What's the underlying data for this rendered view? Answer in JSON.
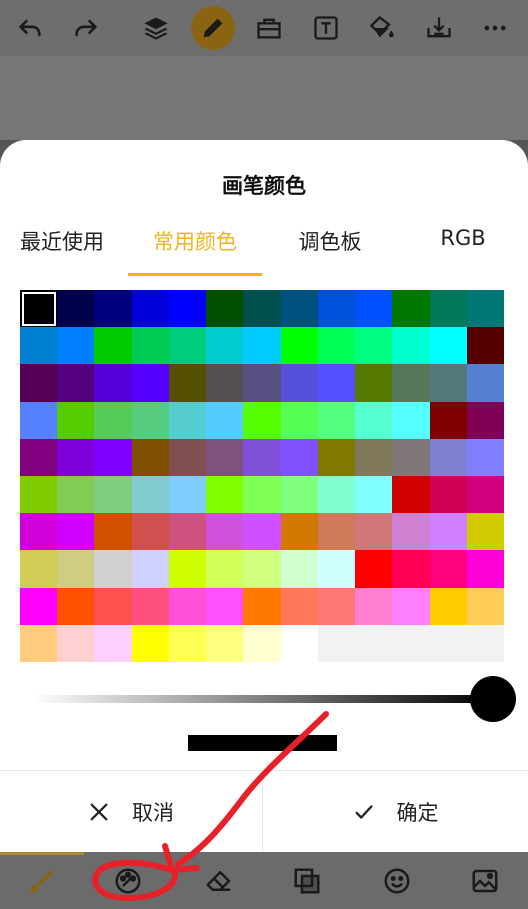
{
  "toolbar": {
    "items": [
      "undo-icon",
      "redo-icon",
      "layers-icon",
      "pen-icon",
      "toolbox-icon",
      "text-icon",
      "fill-bucket-icon",
      "import-icon",
      "more-icon"
    ],
    "active": "pen-icon"
  },
  "sheet": {
    "title": "画笔颜色",
    "tabs": [
      {
        "label": "最近使用",
        "active": false
      },
      {
        "label": "常用颜色",
        "active": true
      },
      {
        "label": "调色板",
        "active": false
      },
      {
        "label": "RGB",
        "active": false
      }
    ],
    "selected_color": "#000000",
    "brightness_level": 1.0,
    "preview_color": "#000000",
    "colors": [
      [
        "#000000",
        "#00004b",
        "#00007f",
        "#0000d9",
        "#0000ff",
        "#005000",
        "#005050",
        "#00507f",
        "#0050d9",
        "#0050ff",
        "#007800",
        "#00785a",
        "#007878"
      ],
      [
        "#0080d0",
        "#0080ff",
        "#00cc00",
        "#00cc55",
        "#00cc80",
        "#00ccd0",
        "#00ccff",
        "#00ff00",
        "#00ff55",
        "#00ff80",
        "#00ffd0",
        "#00ffff",
        "#550000"
      ],
      [
        "#550055",
        "#55007f",
        "#5500d9",
        "#5500ff",
        "#555000",
        "#555050",
        "#55507f",
        "#5550d9",
        "#5550ff",
        "#557800",
        "#55785a",
        "#557878",
        "#5580d0"
      ],
      [
        "#5580ff",
        "#55cc00",
        "#55cc55",
        "#55cc80",
        "#55ccd0",
        "#55ccff",
        "#55ff00",
        "#55ff55",
        "#55ff80",
        "#55ffd0",
        "#55ffff",
        "#800000",
        "#800055"
      ],
      [
        "#80007f",
        "#8000d9",
        "#8000ff",
        "#805000",
        "#805050",
        "#80507f",
        "#8050d9",
        "#8050ff",
        "#807800",
        "#80785a",
        "#807878",
        "#8080d0",
        "#8080ff"
      ],
      [
        "#80cc00",
        "#80cc55",
        "#80cc80",
        "#80ccd0",
        "#80ccff",
        "#80ff00",
        "#80ff55",
        "#80ff80",
        "#80ffd0",
        "#80ffff",
        "#d00000",
        "#d00055",
        "#d0007f"
      ],
      [
        "#d000d9",
        "#d000ff",
        "#d05000",
        "#d05050",
        "#d0507f",
        "#d050d9",
        "#d050ff",
        "#d07800",
        "#d0785a",
        "#d07878",
        "#d080d0",
        "#d080ff",
        "#d0cc00"
      ],
      [
        "#d0cc55",
        "#d0cc80",
        "#d0d0d0",
        "#d0d0ff",
        "#d0ff00",
        "#d0ff55",
        "#d0ff80",
        "#d0ffd0",
        "#d0ffff",
        "#ff0000",
        "#ff0055",
        "#ff007f",
        "#ff00d9"
      ],
      [
        "#ff00ff",
        "#ff5000",
        "#ff5050",
        "#ff507f",
        "#ff50d9",
        "#ff50ff",
        "#ff7800",
        "#ff785a",
        "#ff7878",
        "#ff80d0",
        "#ff80ff",
        "#ffcc00",
        "#ffcc55"
      ],
      [
        "#ffcc80",
        "#ffd0d0",
        "#ffd0ff",
        "#ffff00",
        "#ffff55",
        "#ffff80",
        "#ffffd0",
        "#ffffff",
        "#f2f2f2",
        "#f2f2f2",
        "#f2f2f2",
        "#f2f2f2",
        "#f2f2f2"
      ]
    ],
    "cancel_label": "取消",
    "confirm_label": "确定"
  },
  "bottom_bar": {
    "items": [
      "brush-icon",
      "color-palette-icon",
      "eraser-icon",
      "layer-blend-icon",
      "emoji-icon",
      "image-icon"
    ],
    "active": "brush-icon"
  },
  "annotation": {
    "color": "#e8202a"
  }
}
